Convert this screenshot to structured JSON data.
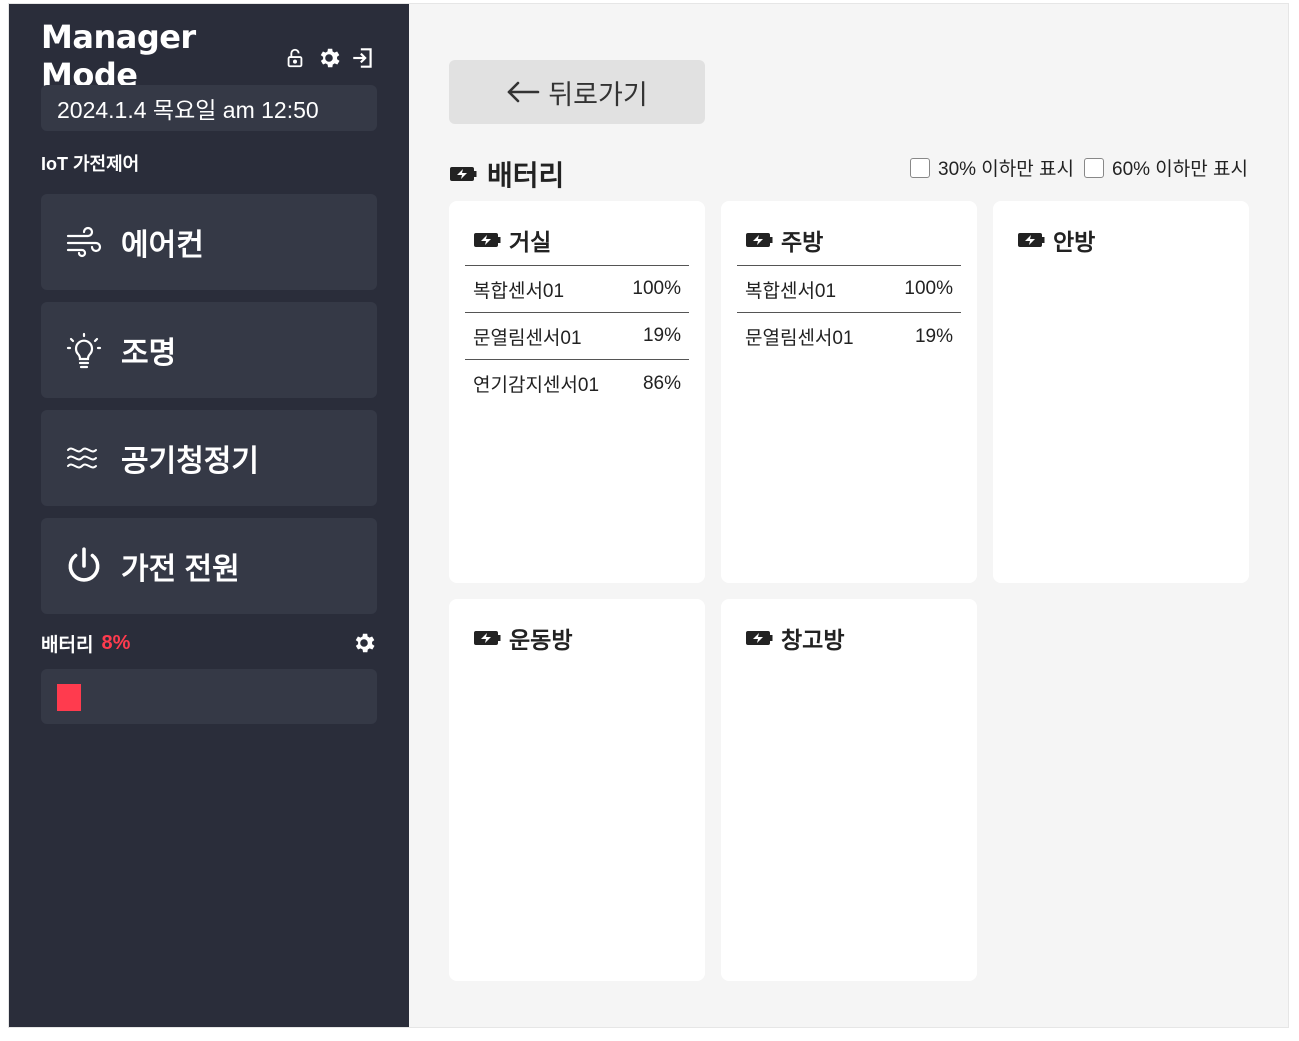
{
  "sidebar": {
    "title": "Manager Mode",
    "icons": [
      "lock-icon",
      "gear-icon",
      "logout-icon"
    ],
    "datetime": "2024.1.4 목요일 am 12:50",
    "section_label": "IoT 가전제어",
    "menu": [
      {
        "label": "에어컨",
        "icon": "wind-icon"
      },
      {
        "label": "조명",
        "icon": "lightbulb-icon"
      },
      {
        "label": "공기청정기",
        "icon": "waves-icon"
      },
      {
        "label": "가전 전원",
        "icon": "power-icon"
      }
    ],
    "battery": {
      "label": "배터리",
      "percent_text": "8%",
      "level": 0.08
    }
  },
  "main": {
    "back_label": "뒤로가기",
    "section_title": "배터리",
    "filters": [
      {
        "label": "30% 이하만 표시",
        "checked": false
      },
      {
        "label": "60% 이하만 표시",
        "checked": false
      }
    ],
    "rooms": [
      {
        "name": "거실",
        "items": [
          {
            "name": "복합센서01",
            "value": "100%"
          },
          {
            "name": "문열림센서01",
            "value": "19%"
          },
          {
            "name": "연기감지센서01",
            "value": "86%"
          }
        ]
      },
      {
        "name": "주방",
        "items": [
          {
            "name": "복합센서01",
            "value": "100%"
          },
          {
            "name": "문열림센서01",
            "value": "19%"
          }
        ]
      },
      {
        "name": "안방",
        "items": []
      },
      {
        "name": "운동방",
        "items": []
      },
      {
        "name": "창고방",
        "items": []
      }
    ]
  },
  "colors": {
    "sidebar_bg": "#2a2d3a",
    "sidebar_panel": "#353946",
    "main_bg": "#f5f5f5",
    "alert": "#ff3b4e"
  }
}
